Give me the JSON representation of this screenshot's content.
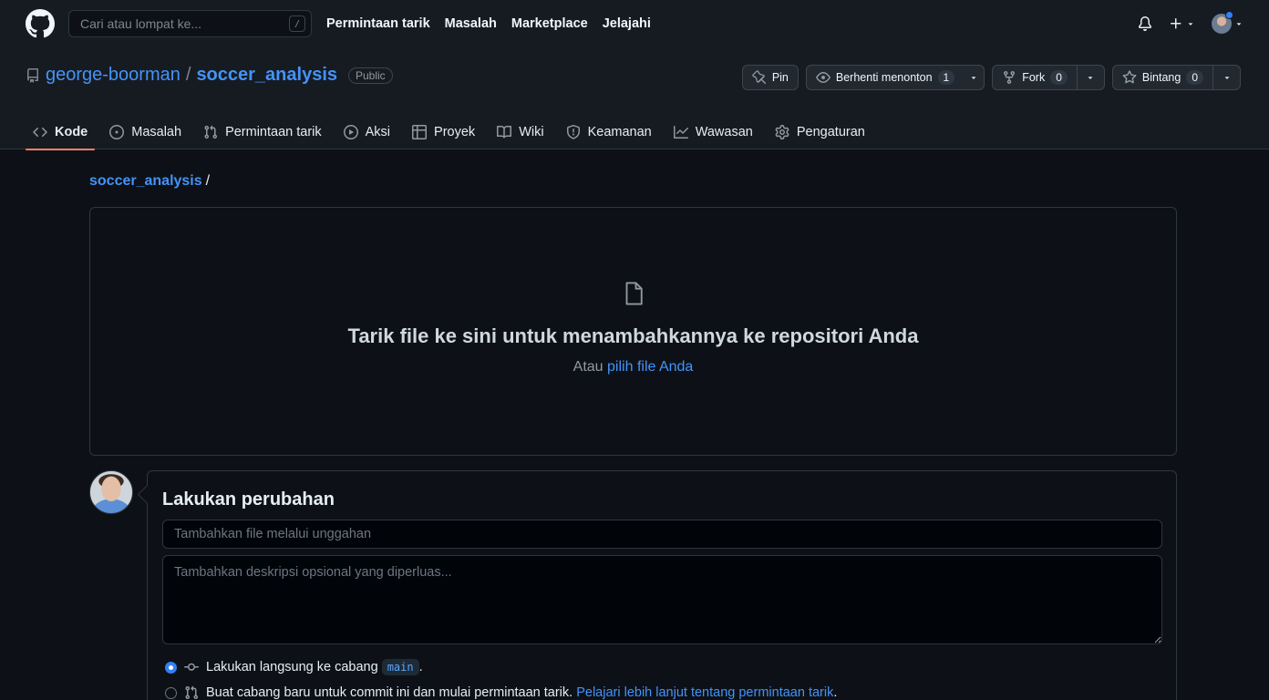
{
  "header": {
    "search_placeholder": "Cari atau lompat ke...",
    "search_key": "/",
    "nav": [
      "Permintaan tarik",
      "Masalah",
      "Marketplace",
      "Jelajahi"
    ]
  },
  "repo": {
    "owner": "george-boorman",
    "separator": "/",
    "name": "soccer_analysis",
    "visibility": "Public",
    "actions": {
      "pin": "Pin",
      "watch": "Berhenti menonton",
      "watch_count": "1",
      "fork": "Fork",
      "fork_count": "0",
      "star": "Bintang",
      "star_count": "0"
    },
    "tabs": [
      "Kode",
      "Masalah",
      "Permintaan tarik",
      "Aksi",
      "Proyek",
      "Wiki",
      "Keamanan",
      "Wawasan",
      "Pengaturan"
    ]
  },
  "upload": {
    "breadcrumb_repo": "soccer_analysis",
    "breadcrumb_sep": "/",
    "drop_title": "Tarik file ke sini untuk menambahkannya ke repositori Anda",
    "drop_sub_prefix": "Atau",
    "drop_sub_link": "pilih file Anda"
  },
  "commit": {
    "title": "Lakukan perubahan",
    "summary_placeholder": "Tambahkan file melalui unggahan",
    "description_placeholder": "Tambahkan deskripsi opsional yang diperluas...",
    "option_direct_prefix": "Lakukan langsung ke cabang",
    "branch": "main",
    "option_direct_suffix": ".",
    "option_new_text": "Buat cabang baru untuk commit ini dan mulai permintaan tarik.",
    "option_new_link": "Pelajari lebih lanjut tentang permintaan tarik",
    "option_new_suffix": "."
  },
  "colors": {
    "background": "#0d1117",
    "header": "#161b22",
    "link": "#4493f8",
    "active_tab_underline": "#f78166",
    "radio_checked": "#2f81f7"
  }
}
